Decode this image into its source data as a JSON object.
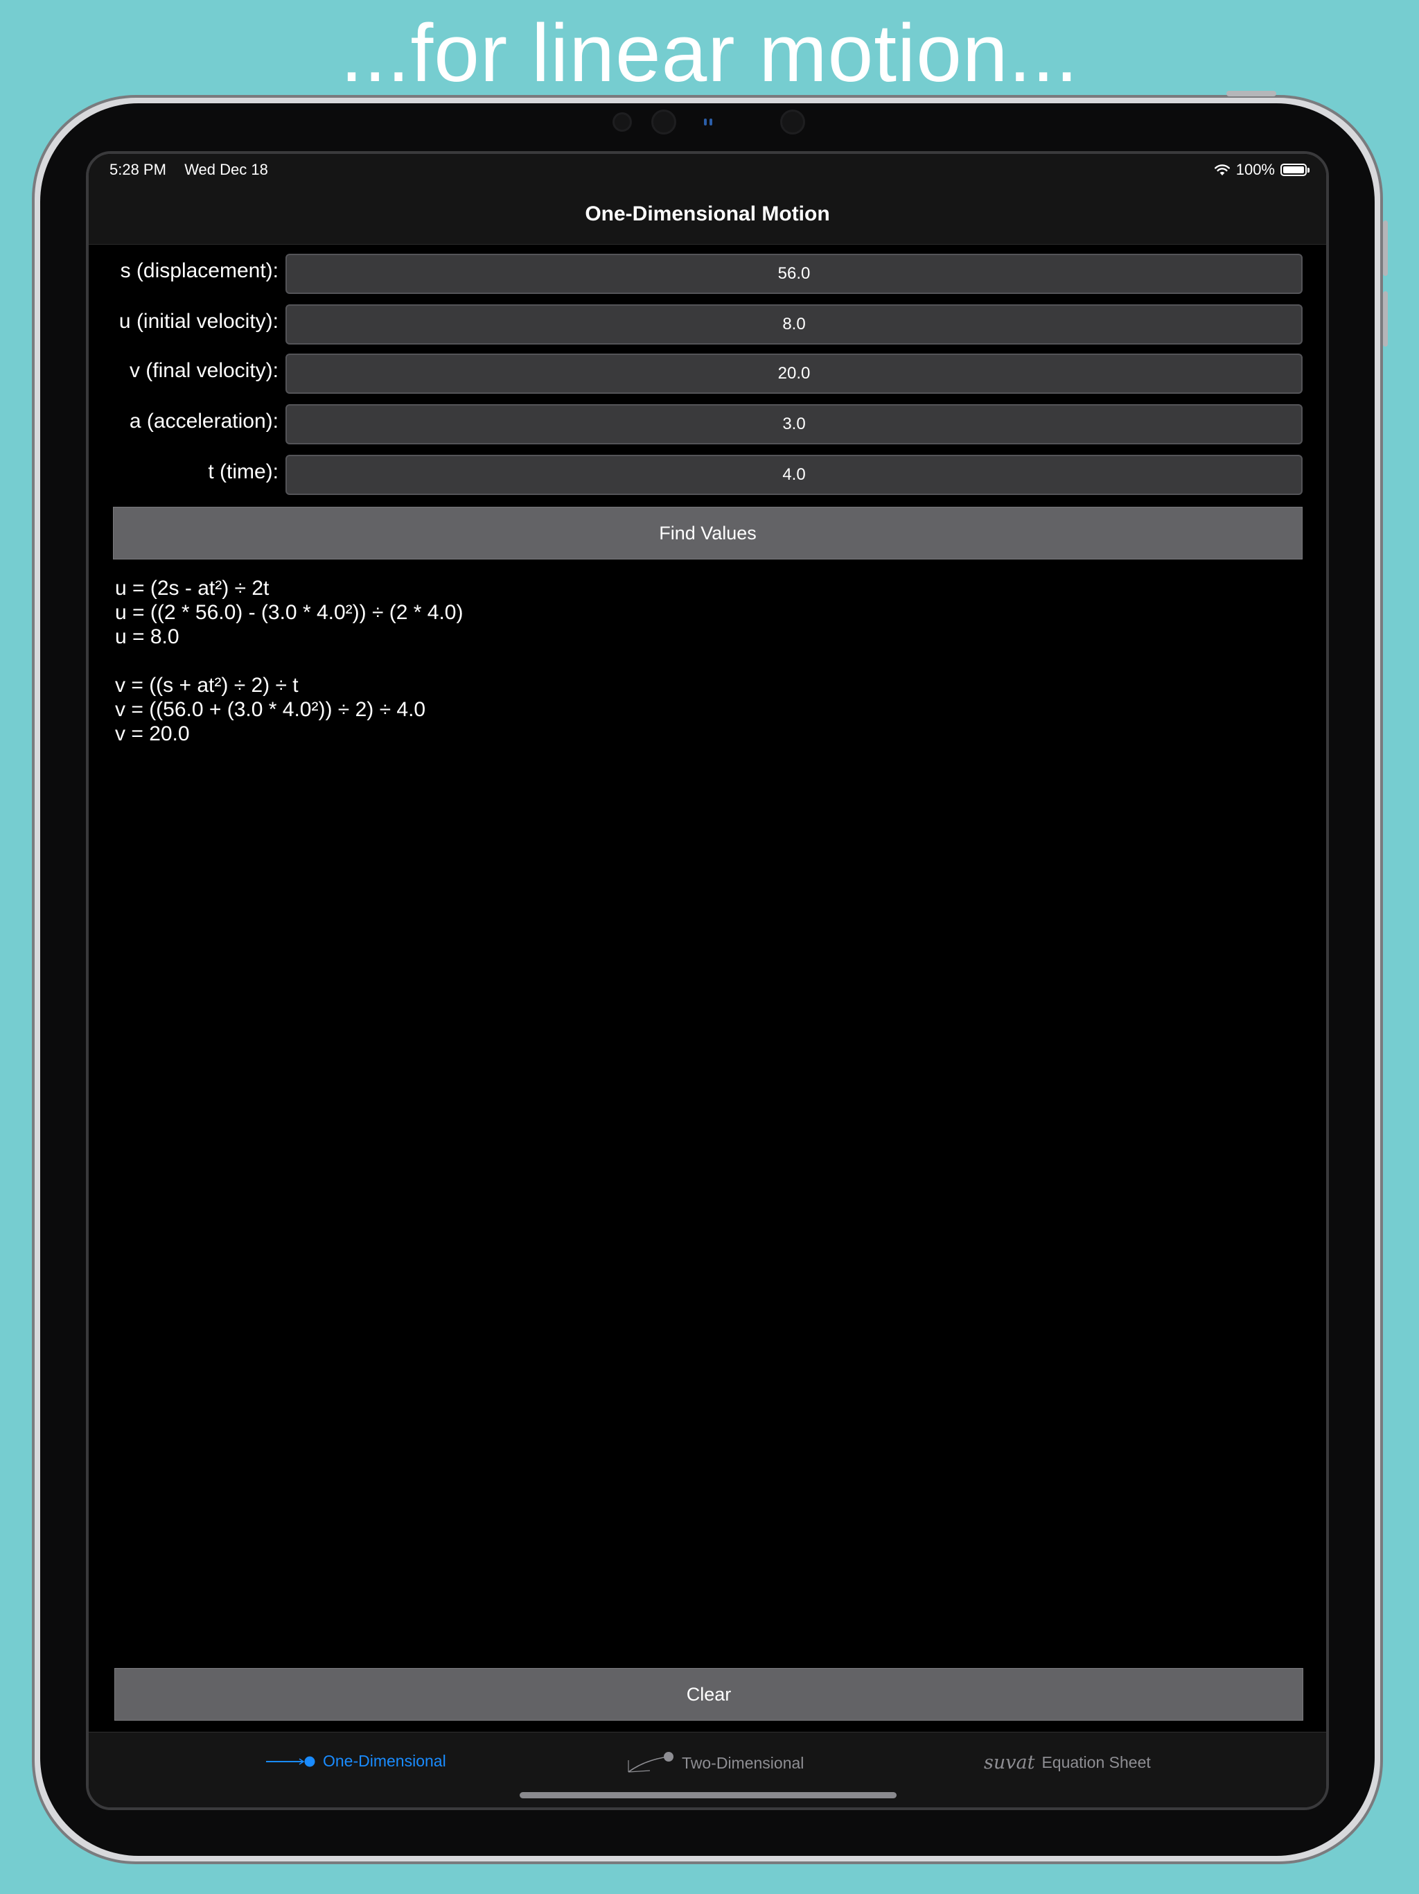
{
  "headline": "...for linear motion...",
  "status_bar": {
    "time": "5:28 PM",
    "date": "Wed Dec 18",
    "battery": "100%",
    "battery_level": 1.0
  },
  "nav": {
    "title": "One-Dimensional Motion"
  },
  "fields": [
    {
      "label": "s (displacement):",
      "value": "56.0"
    },
    {
      "label": "u (initial velocity):",
      "value": "8.0"
    },
    {
      "label": "v (final velocity):",
      "value": "20.0"
    },
    {
      "label": "a (acceleration):",
      "value": "3.0"
    },
    {
      "label": "t (time):",
      "value": "4.0"
    }
  ],
  "find_button": "Find Values",
  "results": {
    "u_formula": "u = (2s - at²) ÷ 2t",
    "u_substituted": "u = ((2 * 56.0) - (3.0 * 4.0²)) ÷ (2 * 4.0)",
    "u_result": "u = 8.0",
    "v_formula": "v = ((s + at²) ÷ 2) ÷ t",
    "v_substituted": "v = ((56.0 + (3.0 * 4.0²)) ÷ 2) ÷ 4.0",
    "v_result": "v = 20.0"
  },
  "clear_button": "Clear",
  "tabs": [
    {
      "label": "One-Dimensional",
      "icon": "linear-arrow-icon"
    },
    {
      "label": "Two-Dimensional",
      "icon": "projectile-curve-icon"
    },
    {
      "label": "Equation Sheet",
      "icon": "suvat-icon",
      "icon_text": "suvat"
    }
  ],
  "colors": {
    "background": "#76cdd0",
    "accent": "#1a8cff",
    "button": "#636366",
    "input": "#3a3a3c"
  }
}
